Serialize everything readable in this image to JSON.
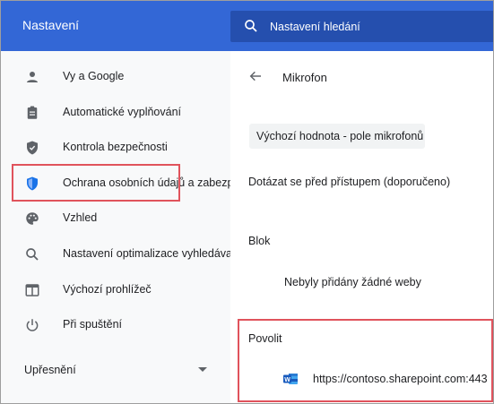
{
  "header": {
    "title": "Nastavení",
    "search_placeholder": "Nastavení hledání"
  },
  "sidebar": {
    "items": [
      {
        "label": "Vy a Google",
        "icon": "person-icon"
      },
      {
        "label": "Automatické vyplňování",
        "icon": "clipboard-icon"
      },
      {
        "label": "Kontrola bezpečnosti",
        "icon": "shield-check-icon"
      },
      {
        "label": "Ochrana osobních údajů a zabezpečení",
        "icon": "shield-icon",
        "active": true
      },
      {
        "label": "Vzhled",
        "icon": "palette-icon"
      },
      {
        "label": "Nastavení optimalizace vyhledávače",
        "icon": "search-icon"
      },
      {
        "label": "Výchozí prohlížeč",
        "icon": "browser-icon"
      },
      {
        "label": "Při spuštění",
        "icon": "power-icon"
      }
    ],
    "advanced_label": "Upřesnění"
  },
  "content": {
    "title": "Mikrofon",
    "select_value": "Výchozí hodnota - pole mikrofonů (R",
    "ask_label": "Dotázat se před přístupem (doporučeno)",
    "block_label": "Blok",
    "block_empty": "Nebyly přidány žádné weby",
    "allow_label": "Povolit",
    "allowed_site": {
      "url": "https://contoso.sharepoint.com:443",
      "icon": "word-icon",
      "icon_letter": "W"
    }
  },
  "colors": {
    "header": "#3367d6",
    "search_bg": "#254fae",
    "highlight": "#e0535c",
    "active_icon": "#1a73e8"
  }
}
